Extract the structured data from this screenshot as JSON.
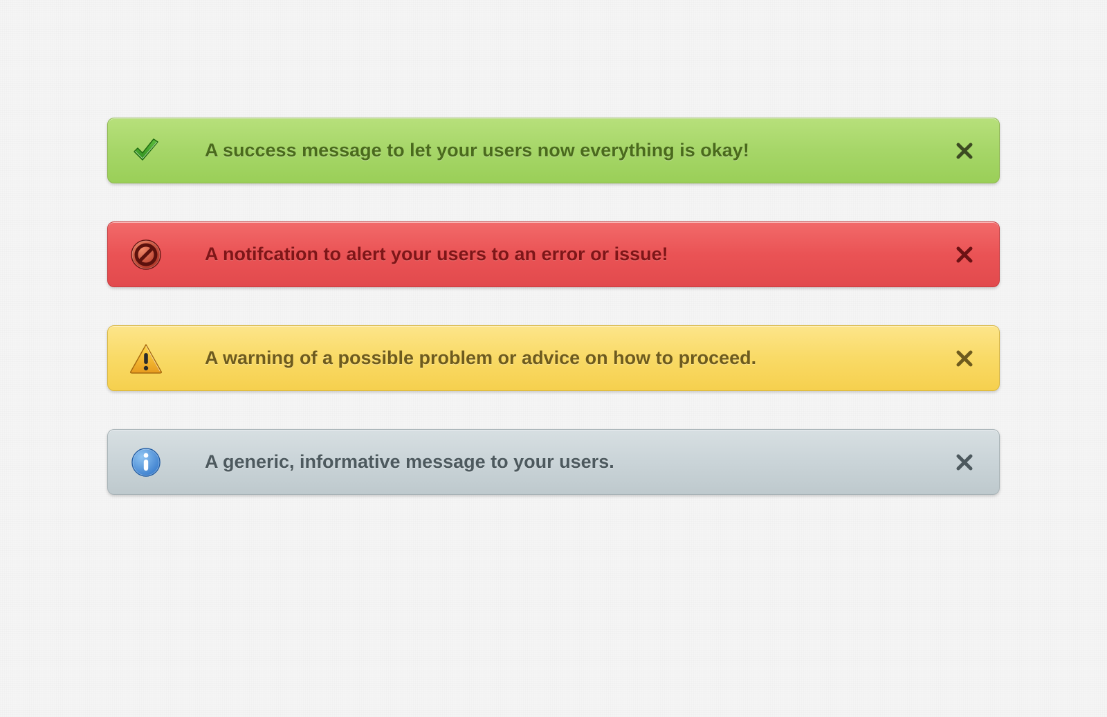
{
  "alerts": [
    {
      "type": "success",
      "message": "A success message to let your users now everything is okay!",
      "icon": "check-icon",
      "color": "#a6d668",
      "text_color": "#4a6a1d",
      "close_color": "#3c4a22"
    },
    {
      "type": "error",
      "message": "A notifcation to alert your users to an error or issue!",
      "icon": "forbidden-icon",
      "color": "#ea5355",
      "text_color": "#7e1618",
      "close_color": "#6b1214"
    },
    {
      "type": "warning",
      "message": "A warning of a possible problem or advice on how to proceed.",
      "icon": "warning-icon",
      "color": "#f9da66",
      "text_color": "#6e5b1e",
      "close_color": "#6e5b1e"
    },
    {
      "type": "info",
      "message": "A generic, informative message to your users.",
      "icon": "info-icon",
      "color": "#cad4d8",
      "text_color": "#4d595e",
      "close_color": "#4d595e"
    }
  ]
}
